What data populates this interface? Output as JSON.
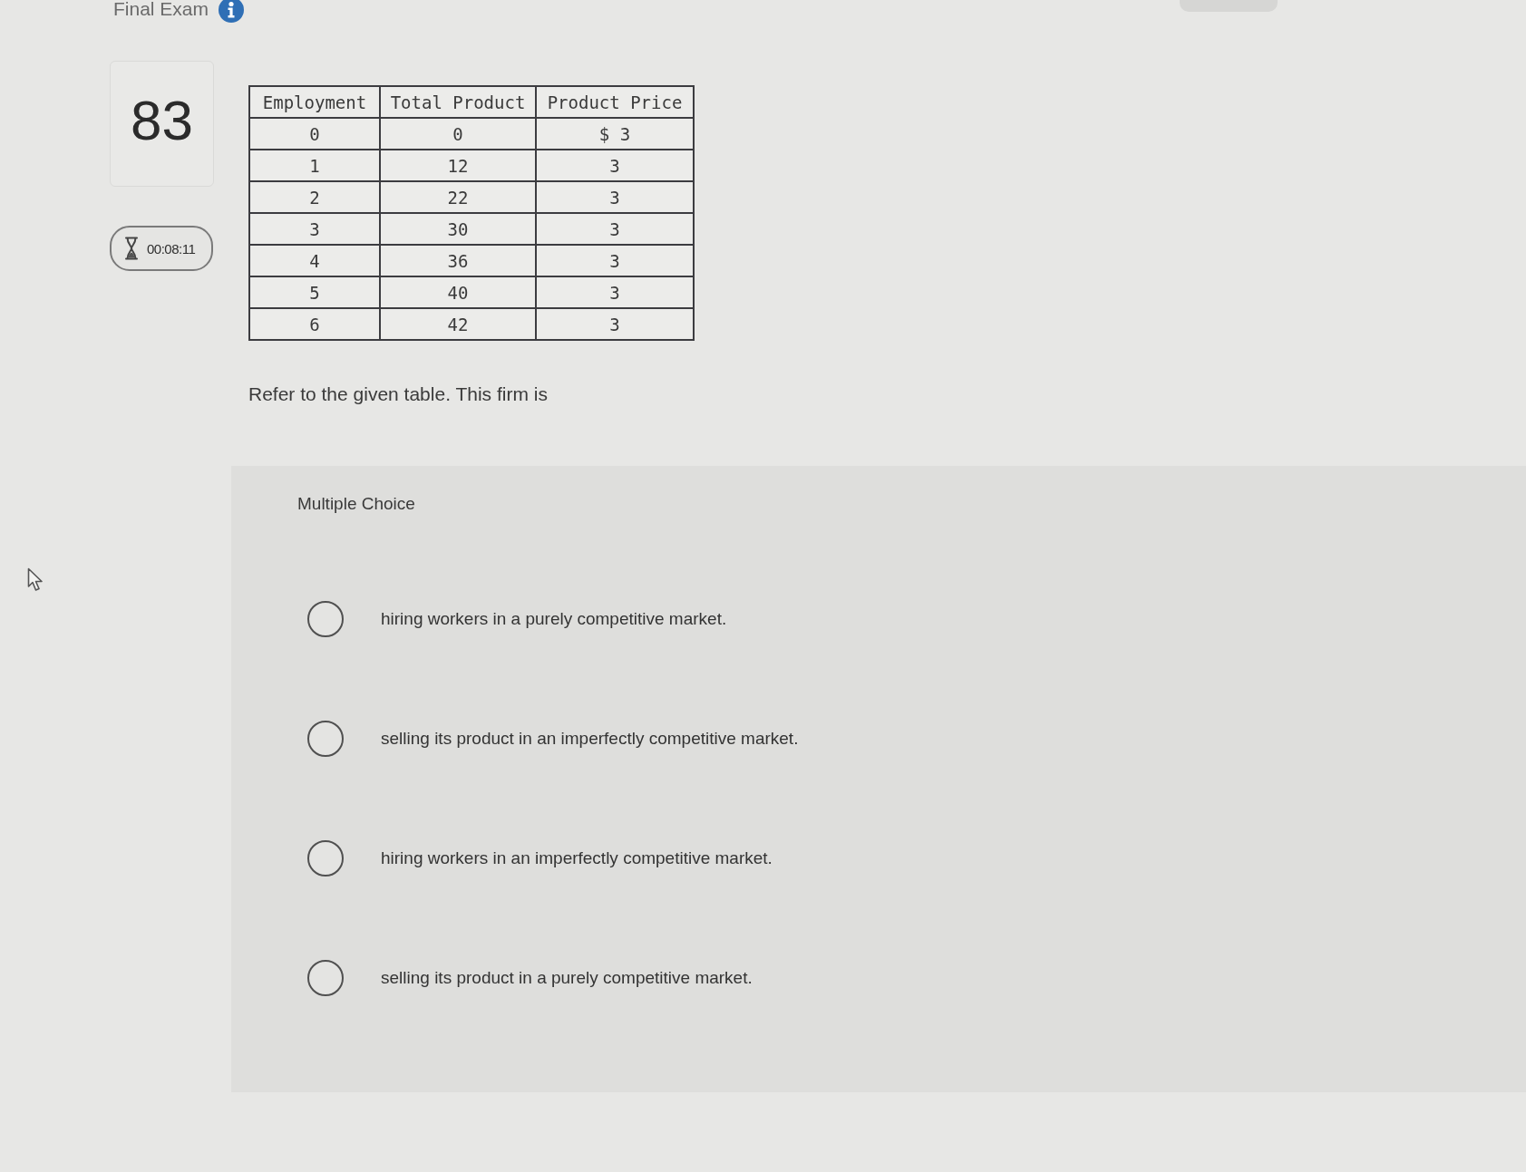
{
  "header": {
    "title": "Final Exam"
  },
  "question": {
    "number": "83",
    "timer": "00:08:11"
  },
  "table": {
    "columns": [
      "Employment",
      "Total Product",
      "Product Price"
    ],
    "rows": [
      [
        "0",
        "0",
        "$ 3"
      ],
      [
        "1",
        "12",
        "3"
      ],
      [
        "2",
        "22",
        "3"
      ],
      [
        "3",
        "30",
        "3"
      ],
      [
        "4",
        "36",
        "3"
      ],
      [
        "5",
        "40",
        "3"
      ],
      [
        "6",
        "42",
        "3"
      ]
    ]
  },
  "prompt": "Refer to the given table. This firm is",
  "answer_panel": {
    "heading": "Multiple Choice",
    "options": [
      {
        "label": "hiring workers in a purely competitive market.",
        "selected": false
      },
      {
        "label": "selling its product in an imperfectly competitive market.",
        "selected": false
      },
      {
        "label": "hiring workers in an imperfectly competitive market.",
        "selected": false
      },
      {
        "label": "selling its product in a purely competitive market.",
        "selected": false
      }
    ]
  }
}
